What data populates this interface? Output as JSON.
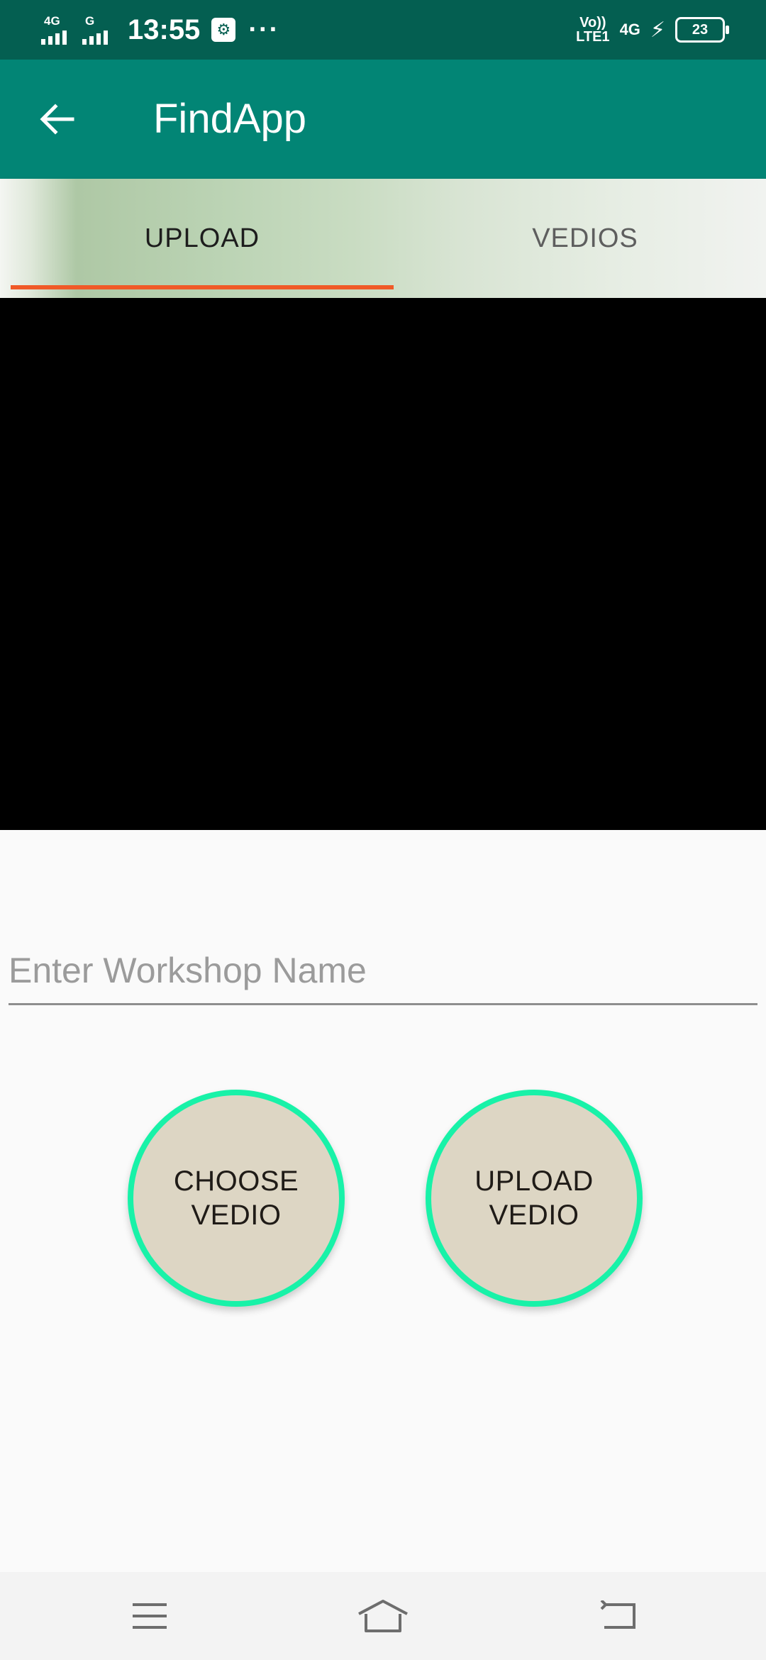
{
  "status_bar": {
    "sim1_net": "4G",
    "sim2_net": "G",
    "time": "13:55",
    "more": "···",
    "volte_top": "Vo))",
    "volte_bottom": "LTE1",
    "data_net": "4G",
    "battery": "23"
  },
  "app_bar": {
    "title": "FindApp"
  },
  "tabs": [
    {
      "label": "UPLOAD",
      "selected": true
    },
    {
      "label": "VEDIOS",
      "selected": false
    }
  ],
  "form": {
    "workshop_placeholder": "Enter Workshop Name",
    "workshop_value": ""
  },
  "buttons": {
    "choose_line1": "CHOOSE",
    "choose_line2": "VEDIO",
    "upload_line1": "UPLOAD",
    "upload_line2": "VEDIO"
  },
  "colors": {
    "status_bar": "#045f51",
    "app_bar": "#028575",
    "tab_indicator": "#f05a28",
    "button_border": "#18f2a8",
    "button_fill": "#ddd6c4"
  },
  "icons": {
    "back": "arrow-left",
    "usb": "usb-debug",
    "nav_menu": "menu-lines",
    "nav_home": "home-outline",
    "nav_back": "return-arrow"
  }
}
